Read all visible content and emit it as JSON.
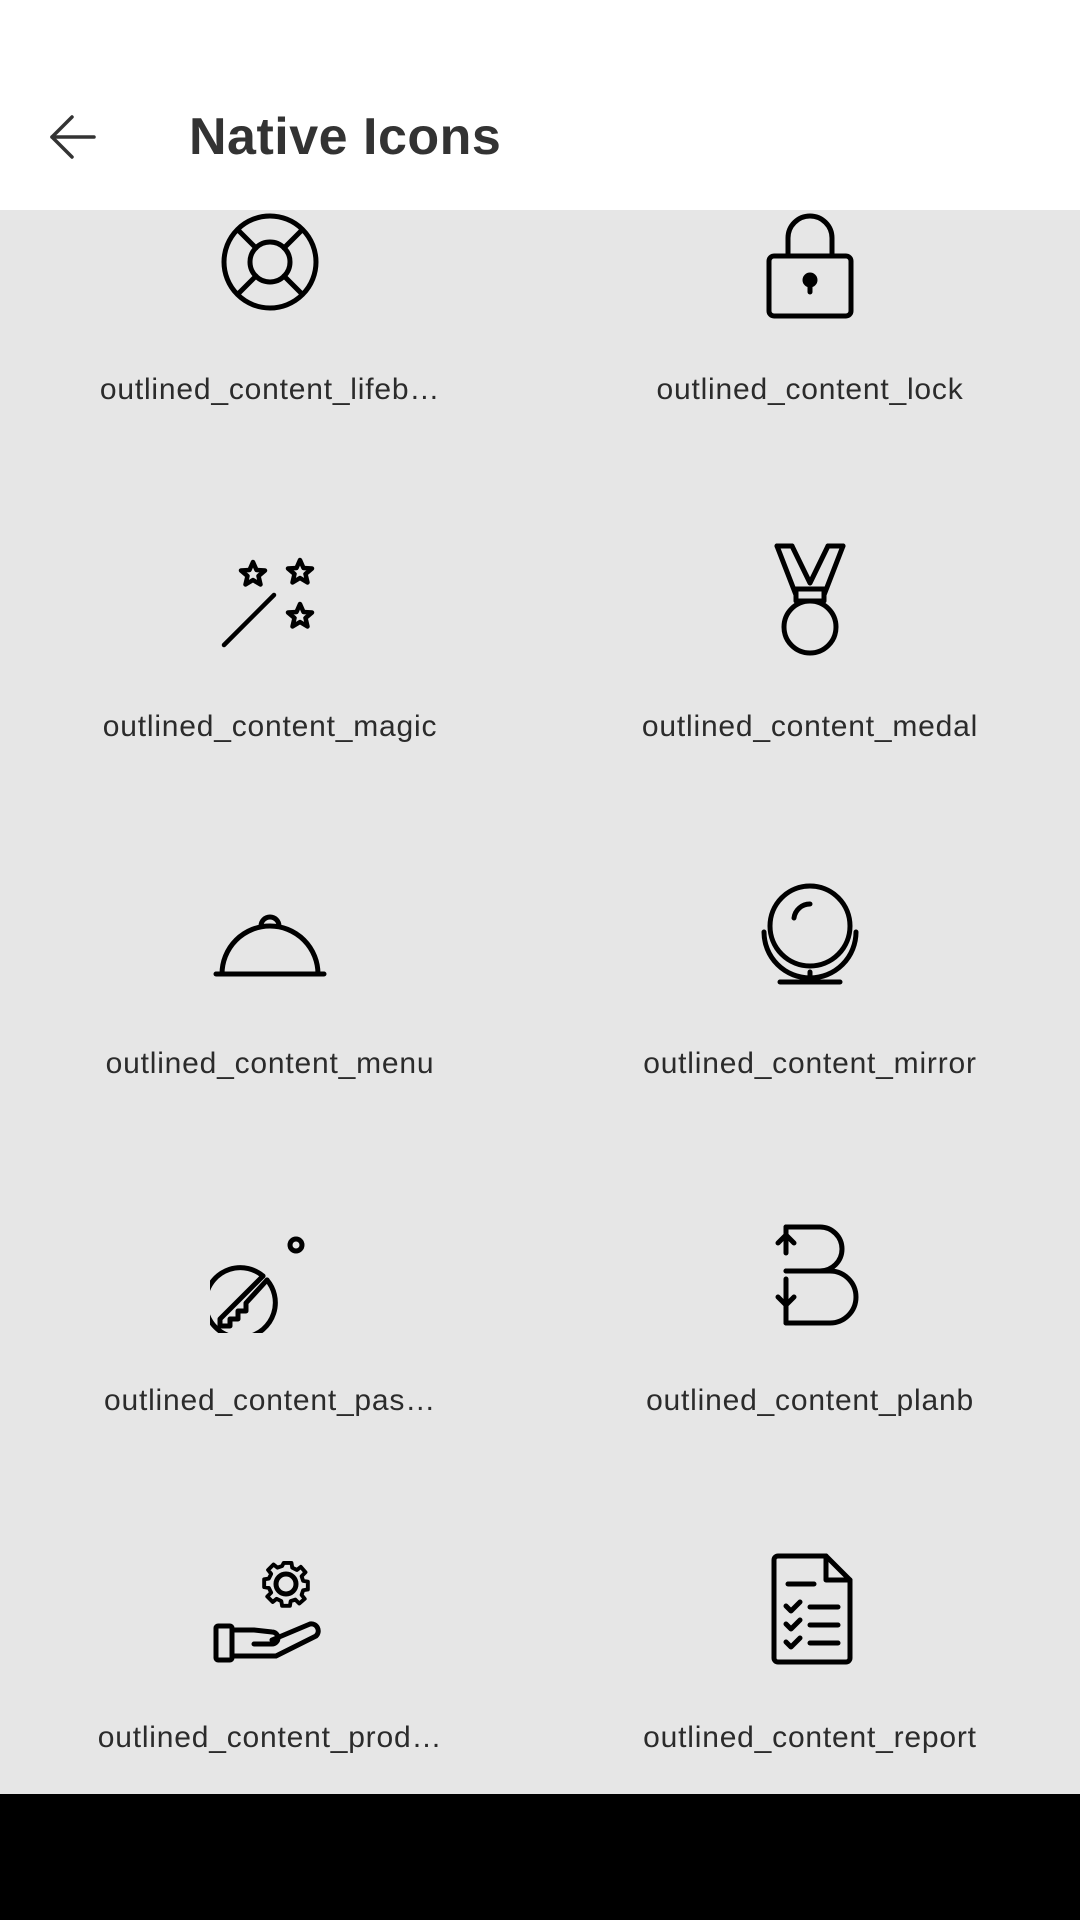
{
  "app_bar": {
    "title": "Native Icons",
    "back_icon": "arrow-left-icon"
  },
  "colors": {
    "app_bar_bg": "#ffffff",
    "content_bg": "#e6e6e6",
    "nav_bar_bg": "#000000",
    "icon_stroke": "#000000",
    "label_text": "#2b2b2b",
    "title_text": "#333333"
  },
  "icons": [
    {
      "label": "outlined_content_lifeb…",
      "icon": "lifebuoy-icon"
    },
    {
      "label": "outlined_content_lock",
      "icon": "lock-icon"
    },
    {
      "label": "outlined_content_magic",
      "icon": "magic-wand-icon"
    },
    {
      "label": "outlined_content_medal",
      "icon": "medal-icon"
    },
    {
      "label": "outlined_content_menu",
      "icon": "cloche-icon"
    },
    {
      "label": "outlined_content_mirror",
      "icon": "mirror-icon"
    },
    {
      "label": "outlined_content_pas…",
      "icon": "key-icon"
    },
    {
      "label": "outlined_content_planb",
      "icon": "plan-b-icon"
    },
    {
      "label": "outlined_content_prod…",
      "icon": "hand-gear-icon"
    },
    {
      "label": "outlined_content_report",
      "icon": "report-icon"
    }
  ]
}
